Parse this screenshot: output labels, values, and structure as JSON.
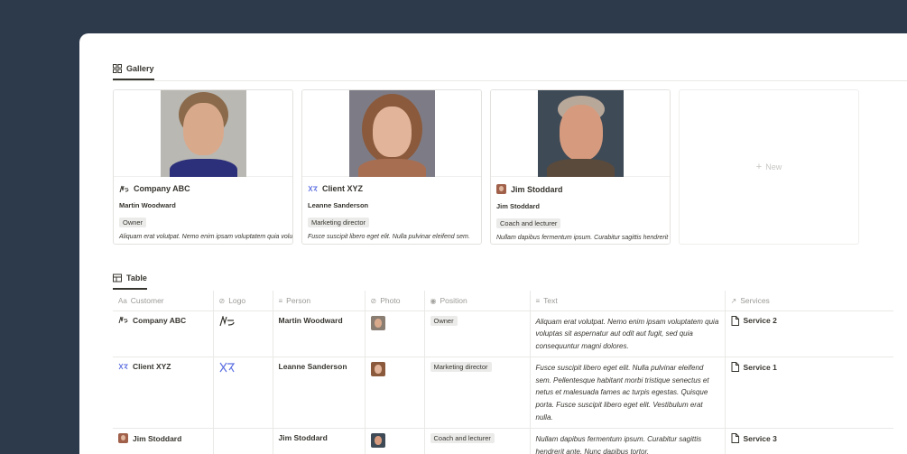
{
  "gallery_view": {
    "tab_label": "Gallery",
    "tab_icon": "grid-icon",
    "new_label": "New"
  },
  "table_view": {
    "tab_label": "Table",
    "tab_icon": "table-icon"
  },
  "cards": [
    {
      "company": "Company ABC",
      "person": "Martin Woodward",
      "position": "Owner",
      "text": "Aliquam erat volutpat. Nemo enim ipsam voluptatem quia voluptas sit aspernatur"
    },
    {
      "company": "Client XYZ",
      "person": "Leanne Sanderson",
      "position": "Marketing director",
      "text": "Fusce suscipit libero eget elit. Nulla pulvinar eleifend sem."
    },
    {
      "company": "Jim Stoddard",
      "person": "Jim Stoddard",
      "position": "Coach and lecturer",
      "text": "Nullam dapibus fermentum ipsum. Curabitur sagittis hendrerit ante."
    }
  ],
  "columns": [
    {
      "label": "Customer",
      "icon": "Aa"
    },
    {
      "label": "Logo",
      "icon": "paperclip-icon"
    },
    {
      "label": "Person",
      "icon": "lines-icon"
    },
    {
      "label": "Photo",
      "icon": "paperclip-icon"
    },
    {
      "label": "Position",
      "icon": "select-icon"
    },
    {
      "label": "Text",
      "icon": "lines-icon"
    },
    {
      "label": "Services",
      "icon": "relation-arrow-icon"
    }
  ],
  "rows": [
    {
      "customer": "Company ABC",
      "person": "Martin Woodward",
      "position": "Owner",
      "text": "Aliquam erat volutpat. Nemo enim ipsam voluptatem quia voluptas sit aspernatur aut odit aut fugit, sed quia consequuntur magni dolores.",
      "service": "Service 2"
    },
    {
      "customer": "Client XYZ",
      "person": "Leanne Sanderson",
      "position": "Marketing director",
      "text": "Fusce suscipit libero eget elit. Nulla pulvinar eleifend sem. Pellentesque habitant morbi tristique senectus et netus et malesuada fames ac turpis egestas. Quisque porta. Fusce suscipit libero eget elit. Vestibulum erat nulla.",
      "service": "Service 1"
    },
    {
      "customer": "Jim Stoddard",
      "person": "Jim Stoddard",
      "position": "Coach and lecturer",
      "text": "Nullam dapibus fermentum ipsum. Curabitur sagittis hendrerit ante. Nunc dapibus tortor.",
      "service": "Service 3"
    }
  ],
  "colors": {
    "background": "#2c3a4b",
    "tag": "#ebebea",
    "logo_blue": "#5b6ee0"
  }
}
